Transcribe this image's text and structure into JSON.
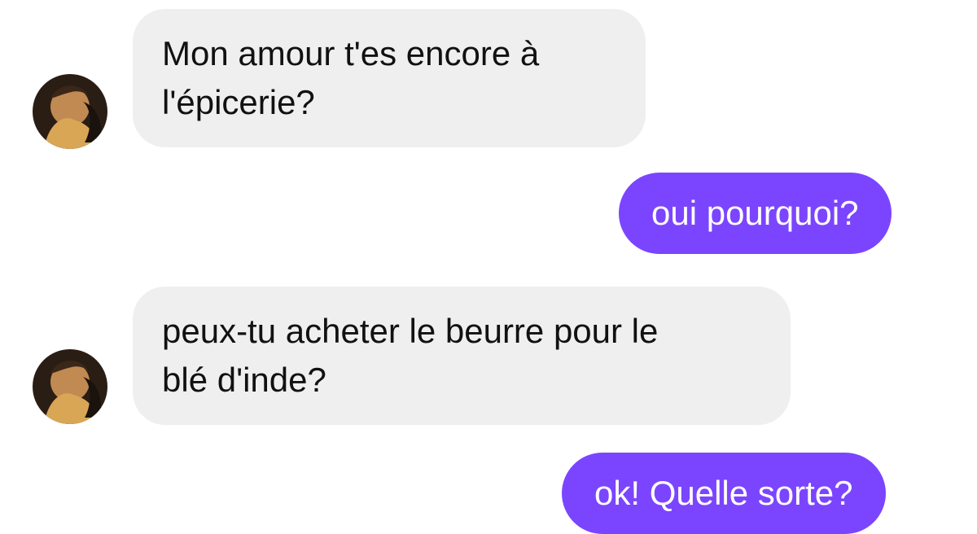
{
  "conversation": {
    "messages": [
      {
        "sender": "contact",
        "lines": [
          "Mon amour t'es encore à",
          "l'épicerie?"
        ]
      },
      {
        "sender": "me",
        "text": "oui pourquoi?"
      },
      {
        "sender": "contact",
        "lines": [
          "peux-tu acheter le beurre pour le",
          "blé d'inde?"
        ]
      },
      {
        "sender": "me",
        "text": "ok! Quelle sorte?"
      }
    ]
  },
  "colors": {
    "incoming_bubble": "#efefef",
    "outgoing_bubble": "#7b45ff",
    "incoming_text": "#111111",
    "outgoing_text": "#ffffff"
  }
}
